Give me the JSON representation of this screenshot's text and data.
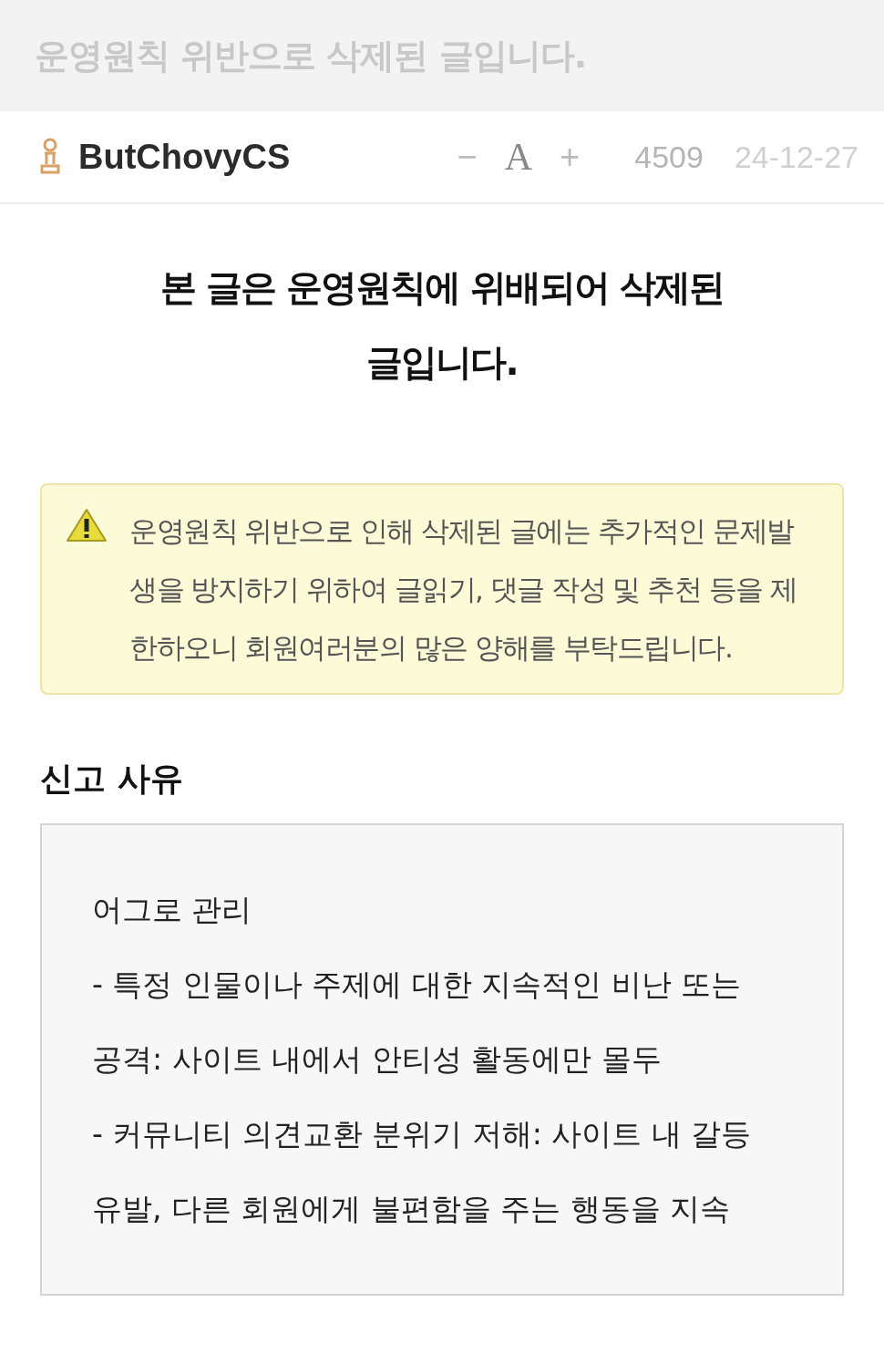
{
  "page_title": "운영원칙 위반으로 삭제된 글입니다.",
  "post_header": {
    "author": "ButChovyCS",
    "font_controls": [
      "−",
      "A",
      "+"
    ],
    "views": "4509",
    "date": "24-12-27"
  },
  "notice_heading": [
    "본 글은 운영원칙에 위배되어 삭제된",
    "글입니다."
  ],
  "warning": {
    "text": "운영원칙 위반으로 인해 삭제된 글에는 추가적인 문제발생을 방지하기 위하여 글읽기, 댓글 작성 및 추천 등을 제한하오니 회원여러분의 많은 양해를 부탁드립니다."
  },
  "report": {
    "heading": "신고 사유",
    "lines": [
      "어그로 관리",
      "- 특정 인물이나 주제에 대한 지속적인 비난 또는 공격: 사이트 내에서 안티성 활동에만 몰두",
      "- 커뮤니티 의견교환 분위기 저해: 사이트 내 갈등 유발, 다른 회원에게 불편함을 주는 행동을 지속"
    ]
  }
}
